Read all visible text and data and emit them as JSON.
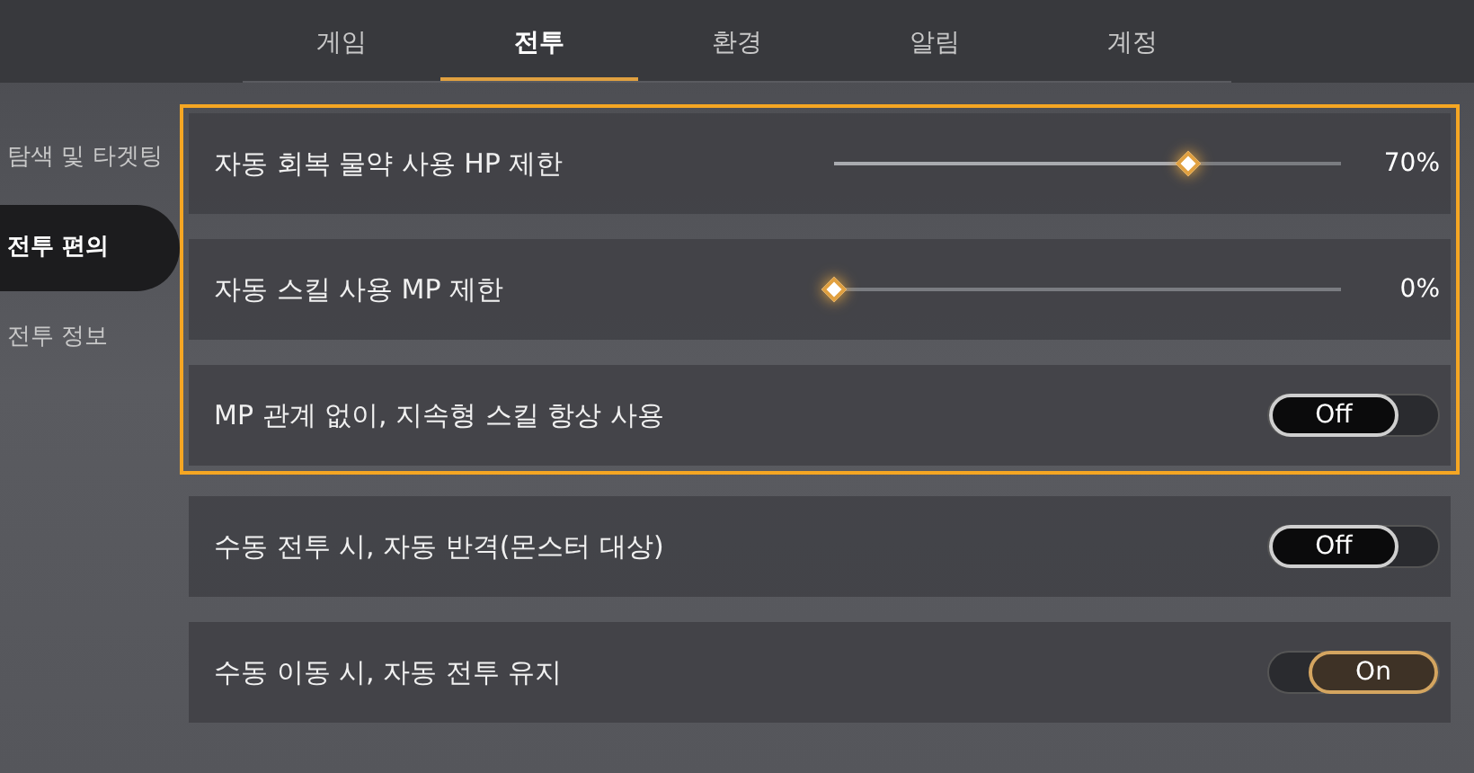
{
  "tabs": [
    {
      "label": "게임",
      "selected": false
    },
    {
      "label": "전투",
      "selected": true
    },
    {
      "label": "환경",
      "selected": false
    },
    {
      "label": "알림",
      "selected": false
    },
    {
      "label": "계정",
      "selected": false
    }
  ],
  "sidebar": {
    "items": [
      {
        "label": "탐색 및 타겟팅",
        "selected": false
      },
      {
        "label": "전투 편의",
        "selected": true
      },
      {
        "label": "전투 정보",
        "selected": false
      }
    ]
  },
  "groups": [
    {
      "highlighted": true,
      "rows": [
        {
          "kind": "slider",
          "label": "자동 회복 물약 사용 HP 제한",
          "level": 0.7,
          "reading": "70%"
        },
        {
          "kind": "slider",
          "label": "자동 스킬 사용 MP 제한",
          "level": 0,
          "reading": "0%"
        },
        {
          "kind": "toggle",
          "label": "MP 관계 없이, 지속형 스킬 항상 사용",
          "on": false,
          "state_label": "Off"
        }
      ]
    },
    {
      "highlighted": false,
      "rows": [
        {
          "kind": "toggle",
          "label": "수동 전투 시, 자동 반격(몬스터 대상)",
          "on": false,
          "state_label": "Off"
        },
        {
          "kind": "toggle",
          "label": "수동 이동 시, 자동 전투 유지",
          "on": true,
          "state_label": "On"
        }
      ]
    }
  ]
}
